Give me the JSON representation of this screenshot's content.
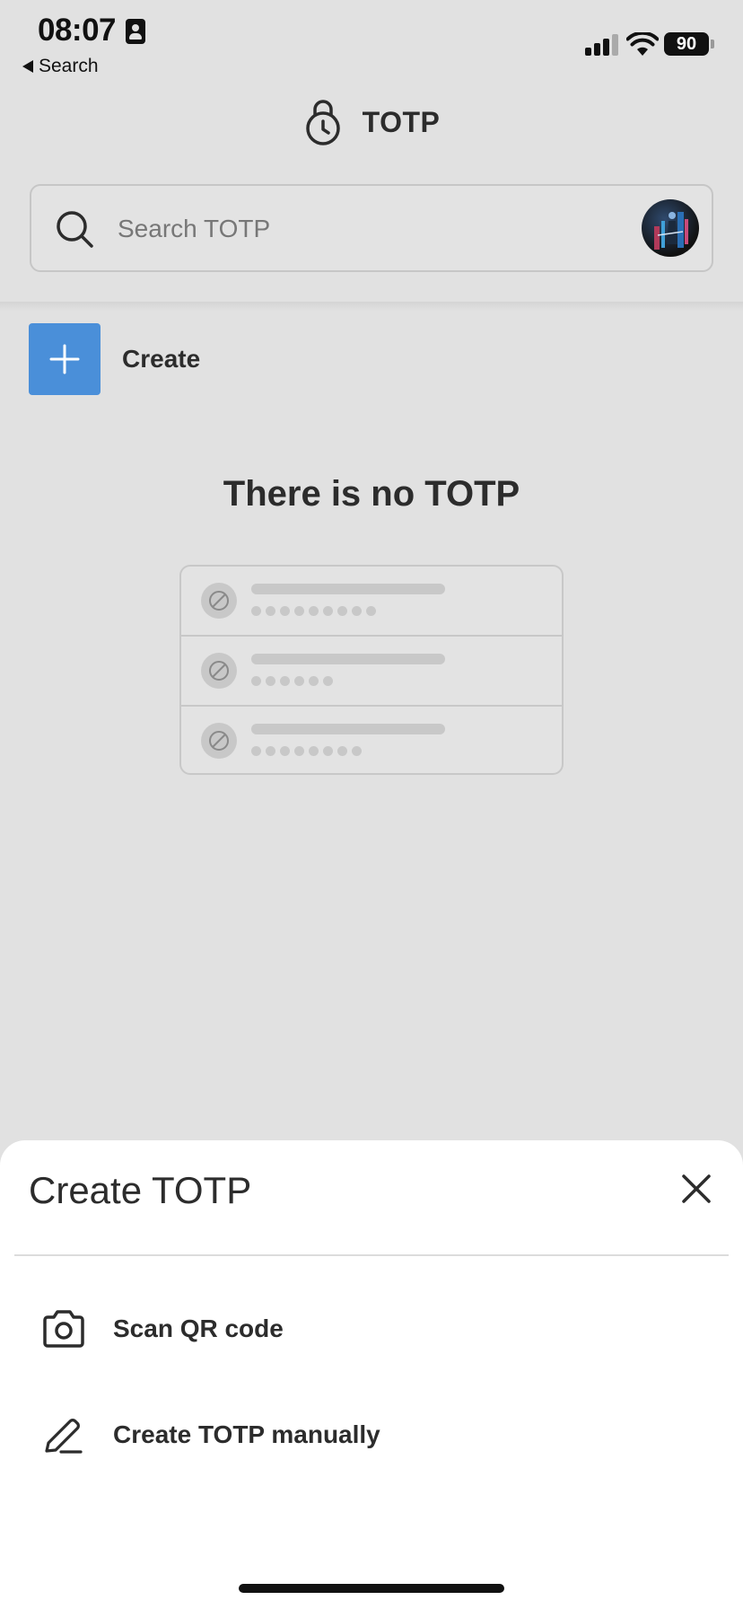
{
  "status_bar": {
    "time": "08:07",
    "back_label": "Search",
    "battery": "90"
  },
  "header": {
    "title": "TOTP",
    "icon": "lock-clock-icon"
  },
  "search": {
    "placeholder": "Search TOTP",
    "value": ""
  },
  "create": {
    "label": "Create",
    "icon": "plus-icon"
  },
  "empty_state": {
    "title": "There is no TOTP",
    "rows": [
      {
        "dot_count": 9
      },
      {
        "dot_count": 6
      },
      {
        "dot_count": 8
      }
    ]
  },
  "sheet": {
    "title": "Create TOTP",
    "items": [
      {
        "label": "Scan QR code",
        "icon": "camera-icon"
      },
      {
        "label": "Create TOTP manually",
        "icon": "pen-icon"
      }
    ]
  },
  "colors": {
    "background": "#e1e1e1",
    "accent": "#4a8fd9",
    "sheet": "#ffffff",
    "text": "#2c2c2c"
  }
}
